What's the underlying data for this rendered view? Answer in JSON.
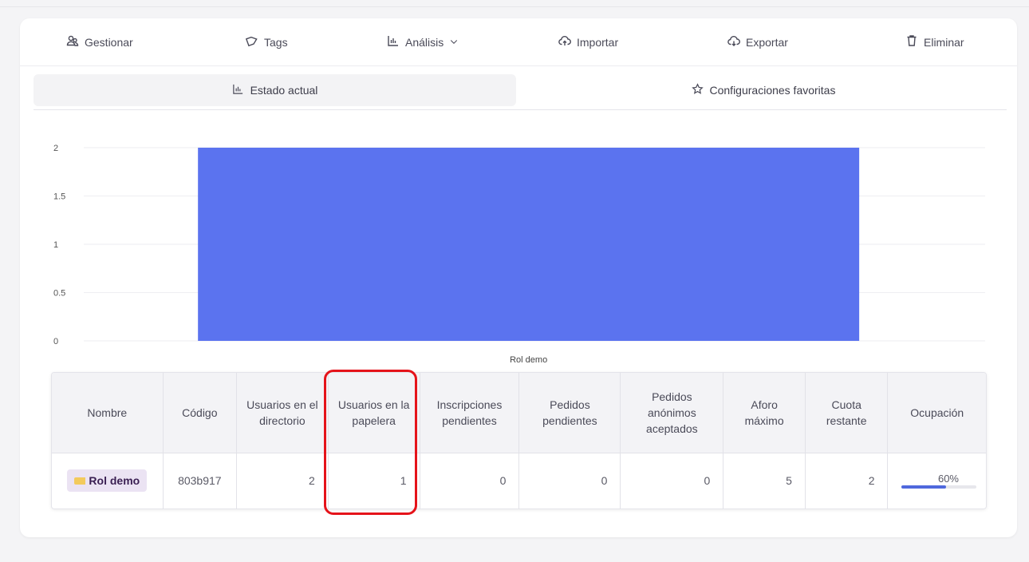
{
  "toolbar": {
    "manage": "Gestionar",
    "tags": "Tags",
    "analysis": "Análisis",
    "import": "Importar",
    "export": "Exportar",
    "delete": "Eliminar"
  },
  "tabs": {
    "current": "Estado actual",
    "favorites": "Configuraciones favoritas"
  },
  "chart_data": {
    "type": "bar",
    "categories": [
      "Rol demo"
    ],
    "values": [
      2
    ],
    "ylim": [
      0,
      2
    ],
    "yticks": [
      "0",
      "0.5",
      "1",
      "1.5",
      "2"
    ],
    "grid": true,
    "color": "#5b73ef"
  },
  "table": {
    "headers": [
      "Nombre",
      "Código",
      "Usuarios en el directorio",
      "Usuarios en la papelera",
      "Inscripciones pendientes",
      "Pedidos pendientes",
      "Pedidos anónimos aceptados",
      "Aforo máximo",
      "Cuota restante",
      "Ocupación"
    ],
    "rows": [
      {
        "name": "Rol demo",
        "code": "803b917",
        "directory_users": "2",
        "trash_users": "1",
        "pending_enrollments": "0",
        "pending_orders": "0",
        "anonymous_orders": "0",
        "max_capacity": "5",
        "remaining_quota": "2",
        "occupancy_label": "60%",
        "occupancy_fraction": 0.6
      }
    ]
  },
  "colors": {
    "bar": "#5b73ef",
    "highlight": "#e5131a",
    "occupancy_fill": "#4f68dd"
  }
}
